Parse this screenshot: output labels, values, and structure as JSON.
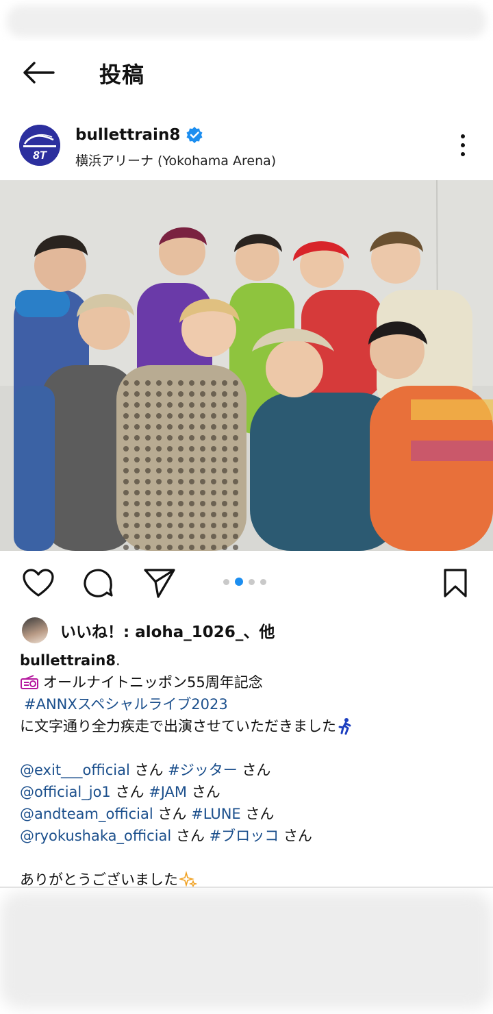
{
  "header": {
    "title": "投稿"
  },
  "post": {
    "username": "bullettrain8",
    "verified": true,
    "location": "横浜アリーナ (Yokohama Arena)",
    "avatar_text": "8T",
    "carousel": {
      "count": 4,
      "active_index": 1
    }
  },
  "likes": {
    "text": "いいね！: aloha_1026_、他"
  },
  "caption": {
    "user": "bullettrain8",
    "user_suffix": " .",
    "line1": "オールナイトニッポン55周年記念",
    "line2": "#ANNXスペシャルライブ2023",
    "line3": "に文字通り全力疾走で出演させていただきました",
    "mentions": [
      {
        "handle": "@exit___official",
        "san1": " さん ",
        "tag": "#ジッター",
        "san2": " さん"
      },
      {
        "handle": "@official_jo1",
        "san1": " さん ",
        "tag": "#JAM",
        "san2": " さん"
      },
      {
        "handle": "@andteam_official",
        "san1": " さん ",
        "tag": "#LUNE",
        "san2": " さん"
      },
      {
        "handle": "@ryokushaka_official",
        "san1": " さん ",
        "tag": "#ブロッコ",
        "san2": " さん"
      }
    ],
    "closing": "ありがとうございました"
  },
  "icons": {
    "back": "arrow-left-icon",
    "verified": "verified-badge-icon",
    "more": "more-vertical-icon",
    "like": "heart-icon",
    "comment": "comment-icon",
    "share": "send-icon",
    "save": "bookmark-icon",
    "radio": "radio-emoji-icon",
    "runner": "runner-emoji-icon",
    "sparkles": "sparkles-emoji-icon"
  },
  "colors": {
    "link": "#1b4f8c",
    "verified": "#1c8ef0",
    "dot_active": "#1c8ef0",
    "dot_inactive": "#c9c9c9",
    "avatar_bg": "#2c2f9e"
  }
}
